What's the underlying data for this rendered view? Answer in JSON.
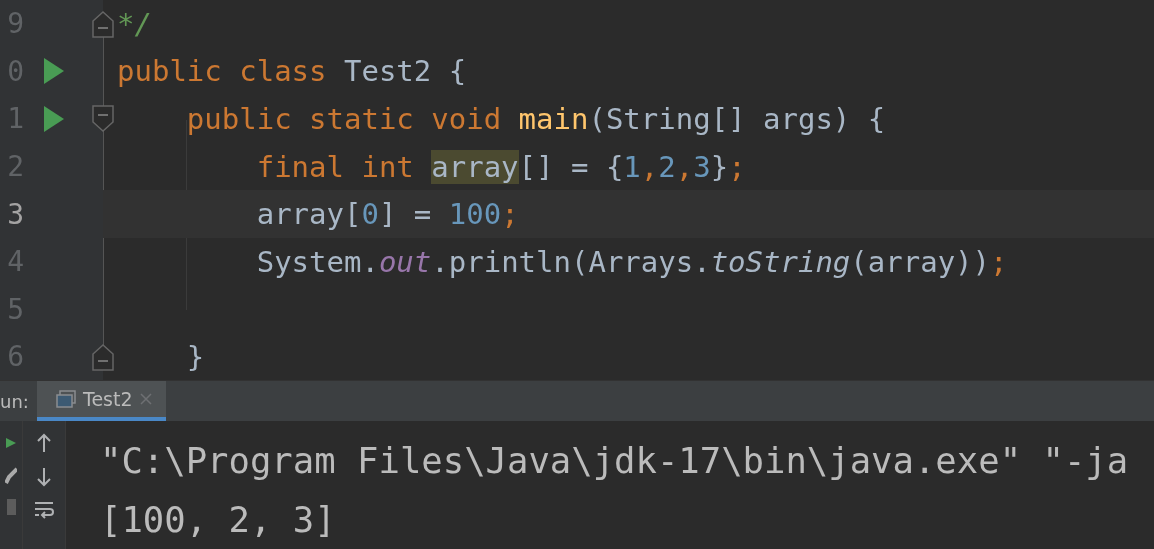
{
  "editor": {
    "lines": [
      {
        "number": "9",
        "run_marker": false,
        "fold_start": false,
        "fold_end": true,
        "current": false,
        "tokens": [
          {
            "kind": "comment",
            "text": "*/"
          }
        ]
      },
      {
        "number": "0",
        "run_marker": true,
        "fold_start": false,
        "fold_end": false,
        "current": false,
        "tokens": [
          {
            "kind": "keyword",
            "text": "public class "
          },
          {
            "kind": "plain",
            "text": "Test2 {"
          }
        ]
      },
      {
        "number": "1",
        "run_marker": true,
        "fold_start": true,
        "fold_end": false,
        "current": false,
        "tokens": [
          {
            "kind": "keyword",
            "text": "    public static void "
          },
          {
            "kind": "method",
            "text": "main"
          },
          {
            "kind": "plain",
            "text": "(String[] args) {"
          }
        ]
      },
      {
        "number": "2",
        "run_marker": false,
        "fold_start": false,
        "fold_end": false,
        "current": false,
        "tokens": [
          {
            "kind": "keyword",
            "text": "        final int "
          },
          {
            "kind": "match",
            "text": "array"
          },
          {
            "kind": "plain",
            "text": "[] = {"
          },
          {
            "kind": "number",
            "text": "1"
          },
          {
            "kind": "keyword",
            "text": ","
          },
          {
            "kind": "number",
            "text": "2"
          },
          {
            "kind": "keyword",
            "text": ","
          },
          {
            "kind": "number",
            "text": "3"
          },
          {
            "kind": "plain",
            "text": "}"
          },
          {
            "kind": "keyword",
            "text": ";"
          }
        ]
      },
      {
        "number": "3",
        "run_marker": false,
        "fold_start": false,
        "fold_end": false,
        "current": true,
        "tokens": [
          {
            "kind": "plain",
            "text": "        array["
          },
          {
            "kind": "number",
            "text": "0"
          },
          {
            "kind": "plain",
            "text": "] = "
          },
          {
            "kind": "number",
            "text": "100"
          },
          {
            "kind": "keyword",
            "text": ";"
          }
        ]
      },
      {
        "number": "4",
        "run_marker": false,
        "fold_start": false,
        "fold_end": false,
        "current": false,
        "tokens": [
          {
            "kind": "plain",
            "text": "        System."
          },
          {
            "kind": "field",
            "text": "out"
          },
          {
            "kind": "plain",
            "text": ".println(Arrays."
          },
          {
            "kind": "static-call",
            "text": "toString"
          },
          {
            "kind": "plain",
            "text": "(array))"
          },
          {
            "kind": "keyword",
            "text": ";"
          }
        ]
      },
      {
        "number": "5",
        "run_marker": false,
        "fold_start": false,
        "fold_end": false,
        "current": false
      },
      {
        "number": "6",
        "run_marker": false,
        "fold_start": false,
        "fold_end": true,
        "current": false,
        "tokens": [
          {
            "kind": "plain",
            "text": "    }"
          }
        ]
      }
    ]
  },
  "run_panel": {
    "label": "un:",
    "tabs": [
      {
        "label": "Test2",
        "selected": true
      }
    ],
    "output": [
      "\"C:\\Program Files\\Java\\jdk-17\\bin\\java.exe\" \"-ja",
      "[100, 2, 3]"
    ]
  }
}
